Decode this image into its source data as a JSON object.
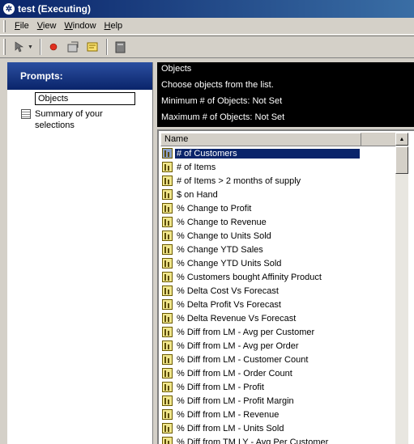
{
  "window": {
    "title": "test (Executing)"
  },
  "menu": [
    {
      "ul": "F",
      "rest": "ile"
    },
    {
      "ul": "V",
      "rest": "iew"
    },
    {
      "ul": "W",
      "rest": "indow"
    },
    {
      "ul": "H",
      "rest": "elp"
    }
  ],
  "toolbar": {
    "icons": [
      "pointer-tool-icon",
      "record-icon",
      "run-icon",
      "note-icon",
      "document-icon"
    ]
  },
  "prompts": {
    "header": "Prompts:",
    "items": [
      "Objects",
      "Summary of your selections"
    ]
  },
  "info": {
    "lines": [
      "Objects",
      "Choose objects from the list.",
      "Minimum # of Objects: Not Set",
      "Maximum # of Objects: Not Set"
    ]
  },
  "list": {
    "column_header": "Name",
    "selected_index": 0,
    "items": [
      "# of Customers",
      "# of Items",
      "# of Items > 2 months of supply",
      "$ on Hand",
      "% Change to Profit",
      "% Change to Revenue",
      "% Change to Units Sold",
      "% Change YTD Sales",
      "% Change YTD Units Sold",
      "% Customers bought Affinity Product",
      "% Delta Cost Vs Forecast",
      "% Delta Profit Vs Forecast",
      "% Delta Revenue Vs Forecast",
      "% Diff from LM - Avg per Customer",
      "% Diff from LM - Avg per Order",
      "% Diff from LM - Customer Count",
      "% Diff from LM - Order Count",
      "% Diff from LM - Profit",
      "% Diff from LM - Profit Margin",
      "% Diff from LM - Revenue",
      "% Diff from LM - Units Sold",
      "% Diff from TM LY - Avg Per Customer"
    ]
  }
}
